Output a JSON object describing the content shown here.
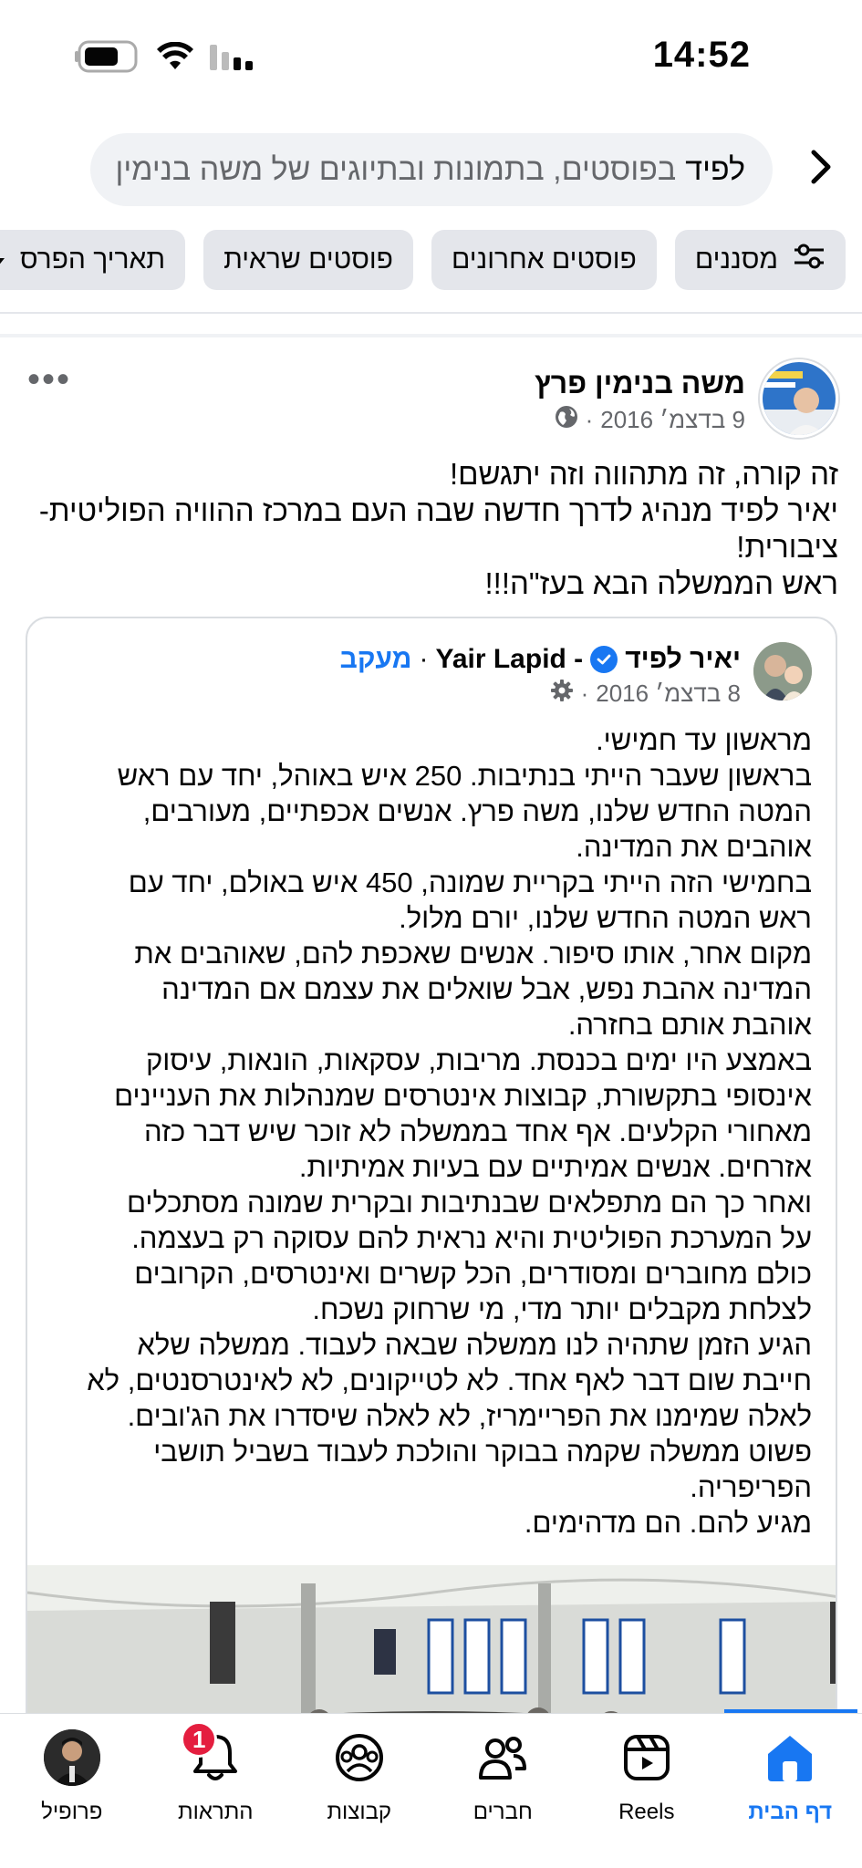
{
  "status_bar": {
    "time": "14:52"
  },
  "search": {
    "term": "לפיד",
    "context": "בפוסטים, בתמונות ובתיוגים של משה בנימין"
  },
  "filters": [
    {
      "label": "מסננים",
      "icon": "sliders-icon"
    },
    {
      "label": "פוסטים אחרונים"
    },
    {
      "label": "פוסטים שראית"
    },
    {
      "label": "תאריך הפרס",
      "icon": "caret-down-icon"
    }
  ],
  "post": {
    "author": "משה בנימין פרץ",
    "date": "9 בדצמ׳ 2016",
    "privacy_icon": "globe-icon",
    "lines": [
      "זה קורה, זה מתהווה וזה יתגשם!",
      "יאיר לפיד מנהיג לדרך חדשה שבה העם במרכז ההוויה הפוליטית-",
      "ציבורית!",
      "ראש הממשלה הבא בעז\"ה!!!"
    ]
  },
  "shared": {
    "name_he": "יאיר  לפיד",
    "name_en": "Yair Lapid -",
    "follow_label": "מעקב",
    "date": "8 בדצמ׳ 2016",
    "privacy_icon": "gear-icon",
    "lines": [
      "מראשון עד חמישי.",
      "בראשון שעבר הייתי בנתיבות. 250 איש באוהל, יחד עם ראש",
      "המטה החדש שלנו, משה פרץ. אנשים אכפתיים, מעורבים,",
      "אוהבים את המדינה.",
      "בחמישי הזה הייתי בקריית שמונה, 450 איש באולם, יחד עם",
      "ראש המטה החדש שלנו, יורם מלול.",
      "מקום אחר, אותו סיפור. אנשים שאכפת להם, שאוהבים את",
      "המדינה אהבת נפש, אבל שואלים את עצמם אם המדינה",
      "אוהבת אותם בחזרה.",
      "באמצע היו ימים בכנסת. מריבות, עסקאות, הונאות, עיסוק",
      "אינסופי בתקשורת, קבוצות אינטרסים שמנהלות את העניינים",
      "מאחורי הקלעים. אף אחד בממשלה לא זוכר שיש דבר כזה",
      "אזרחים. אנשים אמיתיים עם בעיות אמיתיות.",
      "ואחר כך הם מתפלאים שבנתיבות ובקרית שמונה מסתכלים",
      "על המערכת הפוליטית והיא נראית להם עסוקה רק בעצמה.",
      "כולם מחוברים ומסודרים, הכל קשרים ואינטרסים, הקרובים",
      "לצלחת מקבלים יותר מדי, מי שרחוק נשכח.",
      "הגיע הזמן שתהיה לנו ממשלה שבאה לעבוד. ממשלה שלא",
      "חייבת שום דבר לאף אחד. לא לטייקונים, לא לאינטרסנטים, לא",
      "לאלה שמימנו את הפריימריז, לא לאלה שיסדרו את הג'ובים.",
      "פשוט ממשלה שקמה בבוקר והולכת לעבוד בשביל תושבי",
      "הפריפריה.",
      "מגיע להם. הם מדהימים."
    ]
  },
  "nav": [
    {
      "label": "דף הבית",
      "icon": "home-icon",
      "active": true
    },
    {
      "label": "Reels",
      "icon": "reels-icon"
    },
    {
      "label": "חברים",
      "icon": "friends-icon"
    },
    {
      "label": "קבוצות",
      "icon": "groups-icon"
    },
    {
      "label": "התראות",
      "icon": "bell-icon",
      "badge": "1"
    },
    {
      "label": "פרופיל",
      "icon": "profile-icon"
    }
  ],
  "colors": {
    "accent": "#1877f2",
    "badge": "#e41e3f",
    "chip_bg": "#e4e6eb",
    "muted": "#65676b"
  }
}
